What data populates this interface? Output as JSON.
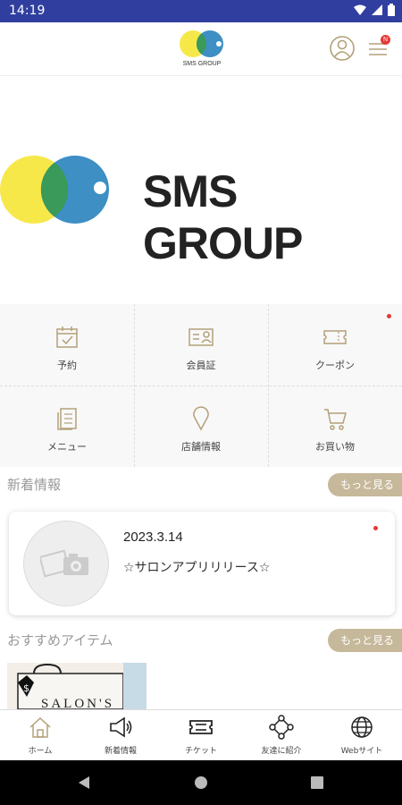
{
  "status_bar": {
    "time": "14:19"
  },
  "header": {
    "logo_text": "SMS GROUP",
    "menu_badge": "N"
  },
  "hero": {
    "brand_text": "SMS GROUP"
  },
  "menu_grid": [
    {
      "label": "予約",
      "icon": "calendar-check-icon"
    },
    {
      "label": "会員証",
      "icon": "member-card-icon"
    },
    {
      "label": "クーポン",
      "icon": "ticket-icon"
    },
    {
      "label": "メニュー",
      "icon": "document-icon"
    },
    {
      "label": "店舗情報",
      "icon": "map-pin-icon"
    },
    {
      "label": "お買い物",
      "icon": "cart-icon"
    }
  ],
  "news": {
    "section_title": "新着情報",
    "more_label": "もっと見る",
    "items": [
      {
        "date": "2023.3.14",
        "title": "☆サロンアプリリリース☆"
      }
    ]
  },
  "recommended": {
    "section_title": "おすすめアイテム",
    "more_label": "もっと見る",
    "item_image_text": "SALON'S"
  },
  "bottom_nav": [
    {
      "label": "ホーム",
      "icon": "home-icon"
    },
    {
      "label": "新着情報",
      "icon": "megaphone-icon"
    },
    {
      "label": "チケット",
      "icon": "ticket-icon"
    },
    {
      "label": "友達に紹介",
      "icon": "share-network-icon"
    },
    {
      "label": "Webサイト",
      "icon": "globe-icon"
    }
  ],
  "colors": {
    "status_bar": "#303f9f",
    "accent": "#c6b89a",
    "icon_stroke": "#b3a078",
    "logo_yellow": "#f7e84a",
    "logo_blue": "#3d8fc4",
    "logo_overlap": "#3a9a5a",
    "notification": "#e53935"
  }
}
